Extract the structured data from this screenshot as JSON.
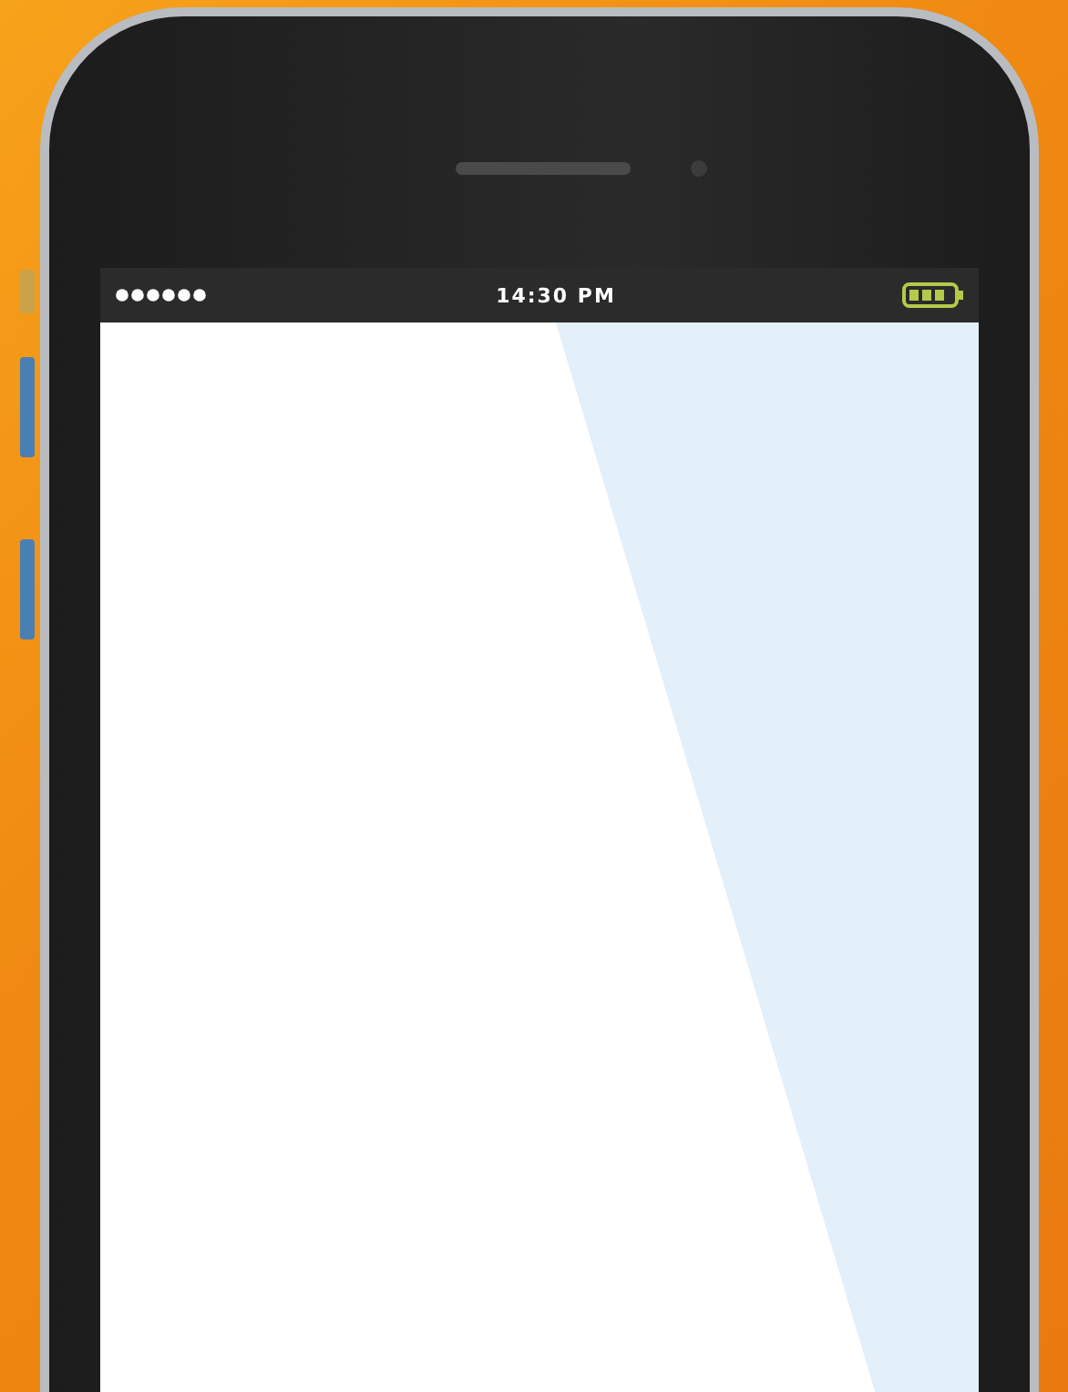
{
  "status_bar": {
    "time": "14:30 PM"
  }
}
